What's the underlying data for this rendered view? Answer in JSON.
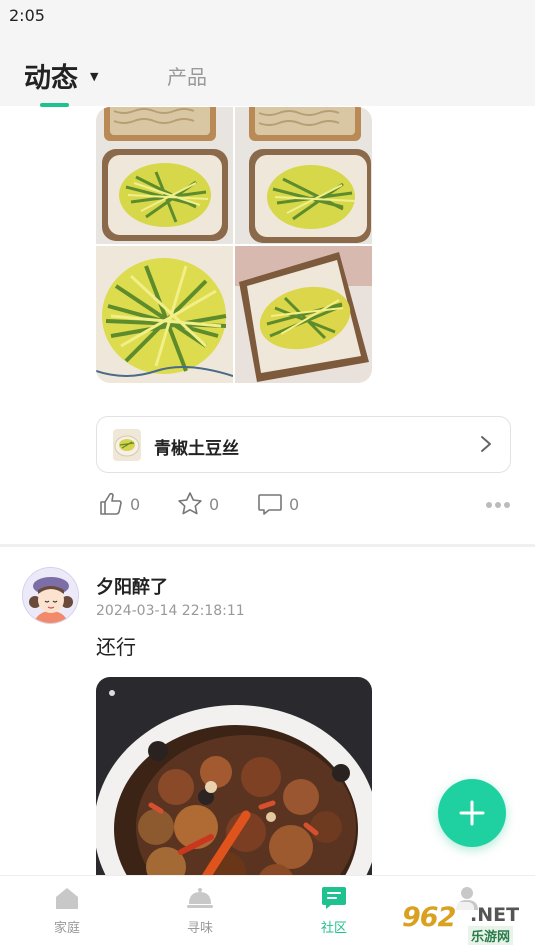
{
  "status_bar": {
    "time": "2:05"
  },
  "header": {
    "tabs": [
      {
        "label": "动态",
        "active": true
      },
      {
        "label": "产品",
        "active": false
      }
    ],
    "dropdown_icon": "caret-down-icon"
  },
  "post1": {
    "photos": [
      "noodles-and-potato-dish",
      "noodles-and-potato-dish",
      "stir-fried-potato-shreds",
      "stir-fried-potato-shreds"
    ],
    "recipe_link": {
      "name": "青椒土豆丝",
      "icon": "chevron-right-icon"
    },
    "actions": {
      "likes": "0",
      "favorites": "0",
      "comments": "0"
    }
  },
  "post2": {
    "username": "夕阳醉了",
    "time": "2024-03-14 22:18:11",
    "text": "还行",
    "photo": "braised-chicken-dish"
  },
  "fab": {
    "icon": "plus-icon"
  },
  "bottom_nav": {
    "items": [
      {
        "label": "家庭",
        "icon": "home-icon",
        "active": false
      },
      {
        "label": "寻味",
        "icon": "cloche-icon",
        "active": false
      },
      {
        "label": "社区",
        "icon": "chat-icon",
        "active": true
      },
      {
        "label": "",
        "icon": "profile-icon",
        "active": false
      }
    ]
  },
  "watermark": {
    "number": "962",
    "net": ".NET",
    "site": "乐游网"
  },
  "colors": {
    "accent": "#1fc18f",
    "fab": "#1fd1a0",
    "muted": "#999999"
  }
}
